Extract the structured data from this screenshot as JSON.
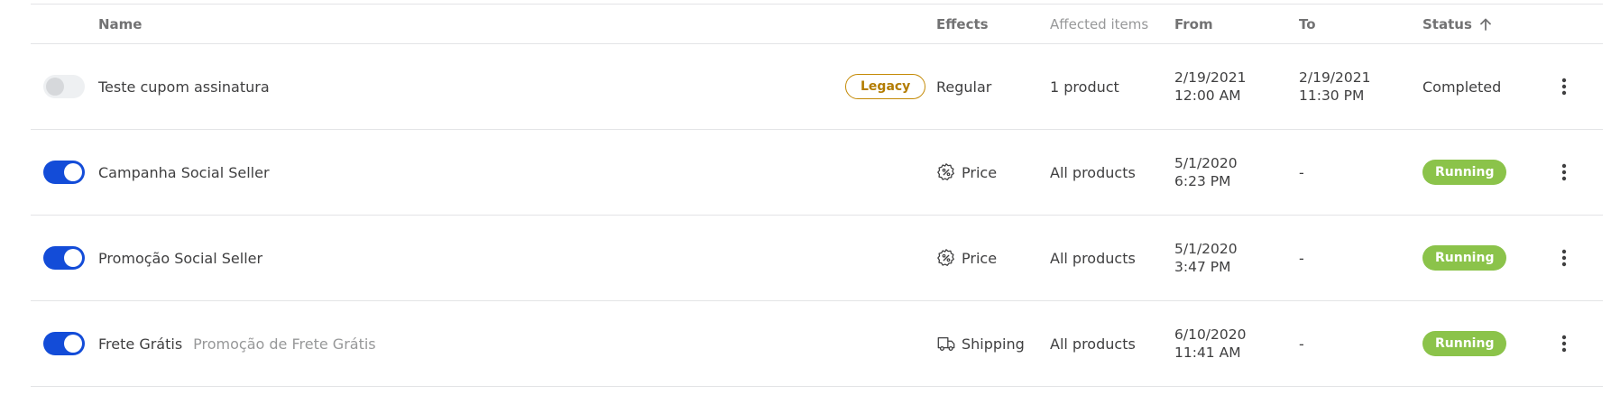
{
  "header": {
    "name": "Name",
    "effects": "Effects",
    "affected_items": "Affected items",
    "from": "From",
    "to": "To",
    "status": "Status"
  },
  "colors": {
    "toggle_on": "#134cd8",
    "running_badge": "#8bc34a",
    "legacy_badge": "#c48a06"
  },
  "rows": [
    {
      "active": false,
      "name": "Teste cupom assinatura",
      "tag": "Legacy",
      "effect": "Regular",
      "effect_icon": "none",
      "items": "1 product",
      "from_date": "2/19/2021",
      "from_time": "12:00 AM",
      "to_date": "2/19/2021",
      "to_time": "11:30 PM",
      "status": "Completed"
    },
    {
      "active": true,
      "name": "Campanha Social Seller",
      "effect": "Price",
      "effect_icon": "price-tag-percent-icon",
      "items": "All products",
      "from_date": "5/1/2020",
      "from_time": "6:23 PM",
      "to": "-",
      "status": "Running"
    },
    {
      "active": true,
      "name": "Promoção Social Seller",
      "effect": "Price",
      "effect_icon": "price-tag-percent-icon",
      "items": "All products",
      "from_date": "5/1/2020",
      "from_time": "3:47 PM",
      "to": "-",
      "status": "Running"
    },
    {
      "active": true,
      "name": "Frete Grátis",
      "subtitle": "Promoção de Frete Grátis",
      "effect": "Shipping",
      "effect_icon": "shipping-truck-icon",
      "items": "All products",
      "from_date": "6/10/2020",
      "from_time": "11:41 AM",
      "to": "-",
      "status": "Running"
    }
  ]
}
